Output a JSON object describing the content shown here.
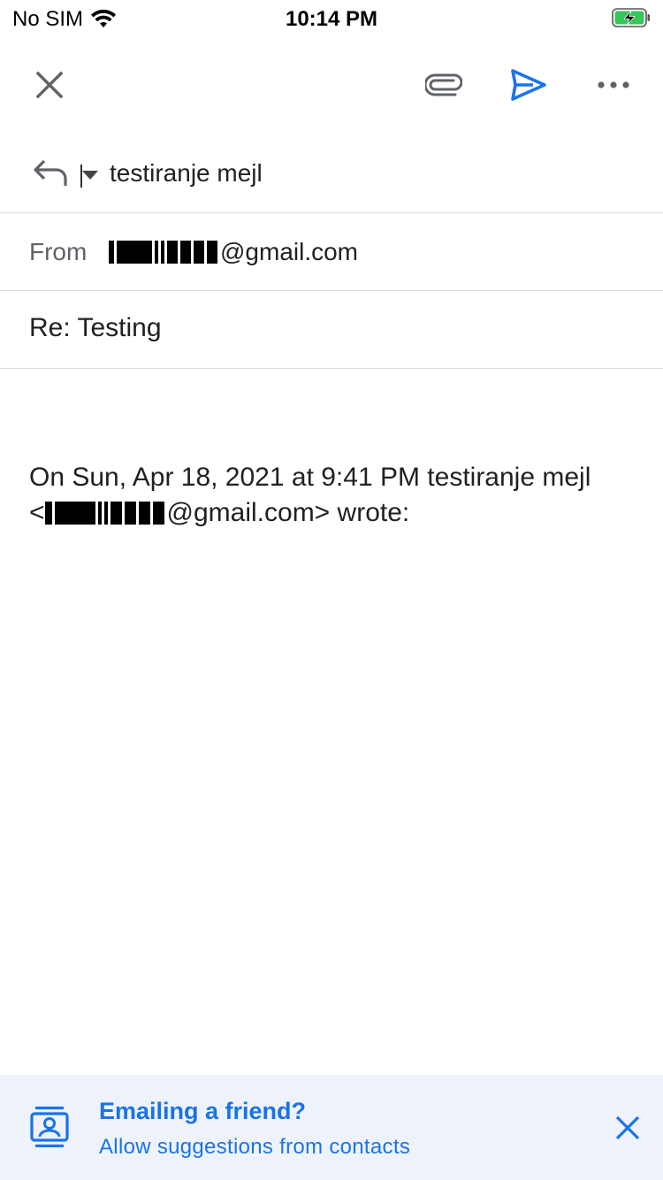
{
  "status_bar": {
    "carrier": "No SIM",
    "time": "10:14 PM",
    "battery_charging": true
  },
  "toolbar": {
    "close_icon": "close-icon",
    "attach_icon": "paperclip-icon",
    "send_icon": "send-icon",
    "more_icon": "more-horizontal-icon",
    "accent_color": "#1a73e8"
  },
  "compose": {
    "to_recipient": "testiranje mejl",
    "from_label": "From",
    "from_email_domain": "@gmail.com",
    "subject": "Re: Testing",
    "quote_header_line1": "On Sun, Apr 18, 2021 at 9:41 PM testiranje mejl",
    "quote_header_open": "<",
    "quote_header_domain_suffix": "@gmail.com> wrote:"
  },
  "banner": {
    "title": "Emailing a friend?",
    "subtitle": "Allow suggestions from contacts",
    "background": "#eef3fb"
  }
}
